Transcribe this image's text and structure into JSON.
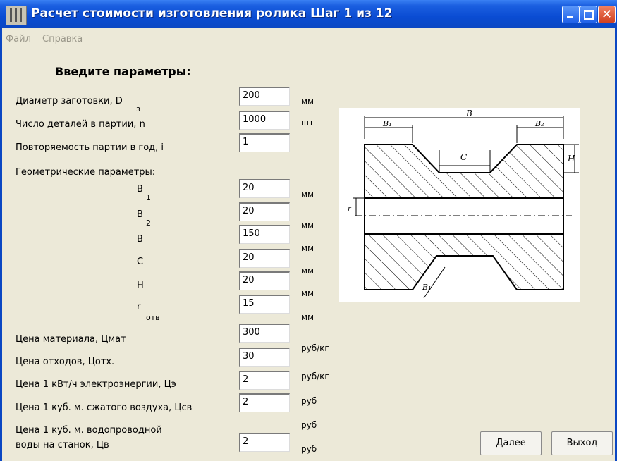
{
  "window": {
    "title": "Расчет стоимости изготовления ролика Шаг 1 из 12"
  },
  "menu": [
    "Файл",
    "Справка"
  ],
  "heading": "Введите параметры:",
  "fields": {
    "diameter": {
      "label": "Диаметр заготовки, D",
      "sub": "з",
      "value": "200",
      "unit": "мм"
    },
    "parts_count": {
      "label": "Число деталей в партии, n",
      "value": "1000",
      "unit": "шт"
    },
    "repeat": {
      "label": "Повторяемость партии в год, i",
      "value": "1"
    },
    "geometry_label": "Геометрические параметры:",
    "B1": {
      "label": "B",
      "sub": "1",
      "value": "20",
      "unit": "мм"
    },
    "B2": {
      "label": "B",
      "sub": "2",
      "value": "20",
      "unit": "мм"
    },
    "B": {
      "label": "B",
      "value": "150",
      "unit": "мм"
    },
    "C": {
      "label": "C",
      "value": "20",
      "unit": "мм"
    },
    "H": {
      "label": "H",
      "value": "20",
      "unit": "мм"
    },
    "r": {
      "label": "r",
      "sub": "отв",
      "value": "15",
      "unit": "мм"
    },
    "material_price": {
      "label": "Цена материала, Цмат",
      "value": "300"
    },
    "waste_price": {
      "label": "Цена отходов, Цотх.",
      "value": "30",
      "unit": "руб/кг"
    },
    "energy_price": {
      "label": "Цена 1 кВт/ч электроэнергии, Цэ",
      "value": "2",
      "unit": "руб/кг"
    },
    "air_price": {
      "label": "Цена 1 куб. м. сжатого воздуха, Цсв",
      "value": "2",
      "unit": "руб"
    },
    "water_price": {
      "label_line1": "Цена 1 куб. м. водопроводной",
      "label_line2": "воды на станок, Цв",
      "value": "2",
      "unit": "руб",
      "unit_above": "руб"
    }
  },
  "drawing": {
    "labels": {
      "B": "B",
      "B1": "B₁",
      "B2": "B₂",
      "C": "C",
      "H": "H",
      "r": "r",
      "B1_bottom": "B₁"
    }
  },
  "buttons": {
    "next": "Далее",
    "exit": "Выход"
  }
}
